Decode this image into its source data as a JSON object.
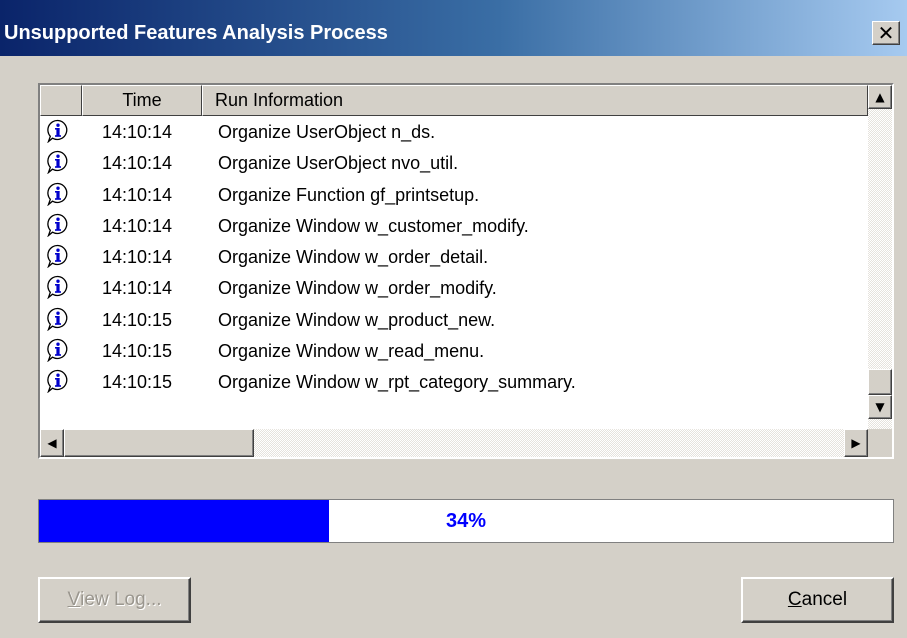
{
  "window": {
    "title": "Unsupported Features Analysis Process",
    "close_glyph": "✕"
  },
  "log": {
    "columns": {
      "icon": "",
      "time": "Time",
      "info": "Run Information"
    },
    "rows": [
      {
        "icon": "info-icon",
        "time": "14:10:14",
        "message": "Organize UserObject n_ds."
      },
      {
        "icon": "info-icon",
        "time": "14:10:14",
        "message": "Organize UserObject nvo_util."
      },
      {
        "icon": "info-icon",
        "time": "14:10:14",
        "message": "Organize Function gf_printsetup."
      },
      {
        "icon": "info-icon",
        "time": "14:10:14",
        "message": "Organize Window w_customer_modify."
      },
      {
        "icon": "info-icon",
        "time": "14:10:14",
        "message": "Organize Window w_order_detail."
      },
      {
        "icon": "info-icon",
        "time": "14:10:14",
        "message": "Organize Window w_order_modify."
      },
      {
        "icon": "info-icon",
        "time": "14:10:15",
        "message": "Organize Window w_product_new."
      },
      {
        "icon": "info-icon",
        "time": "14:10:15",
        "message": "Organize Window w_read_menu."
      },
      {
        "icon": "info-icon",
        "time": "14:10:15",
        "message": "Organize Window w_rpt_category_summary."
      }
    ]
  },
  "progress": {
    "percent": 34,
    "label": "34%",
    "fill_color": "#0000ff"
  },
  "buttons": {
    "view_log": {
      "mnemonic": "V",
      "rest": "iew Log...",
      "enabled": false
    },
    "cancel": {
      "mnemonic": "C",
      "rest": "ancel",
      "enabled": true
    }
  },
  "colors": {
    "title_gradient_start": "#0a246a",
    "title_gradient_end": "#a6caf0",
    "dialog_face": "#d4d0c8"
  }
}
